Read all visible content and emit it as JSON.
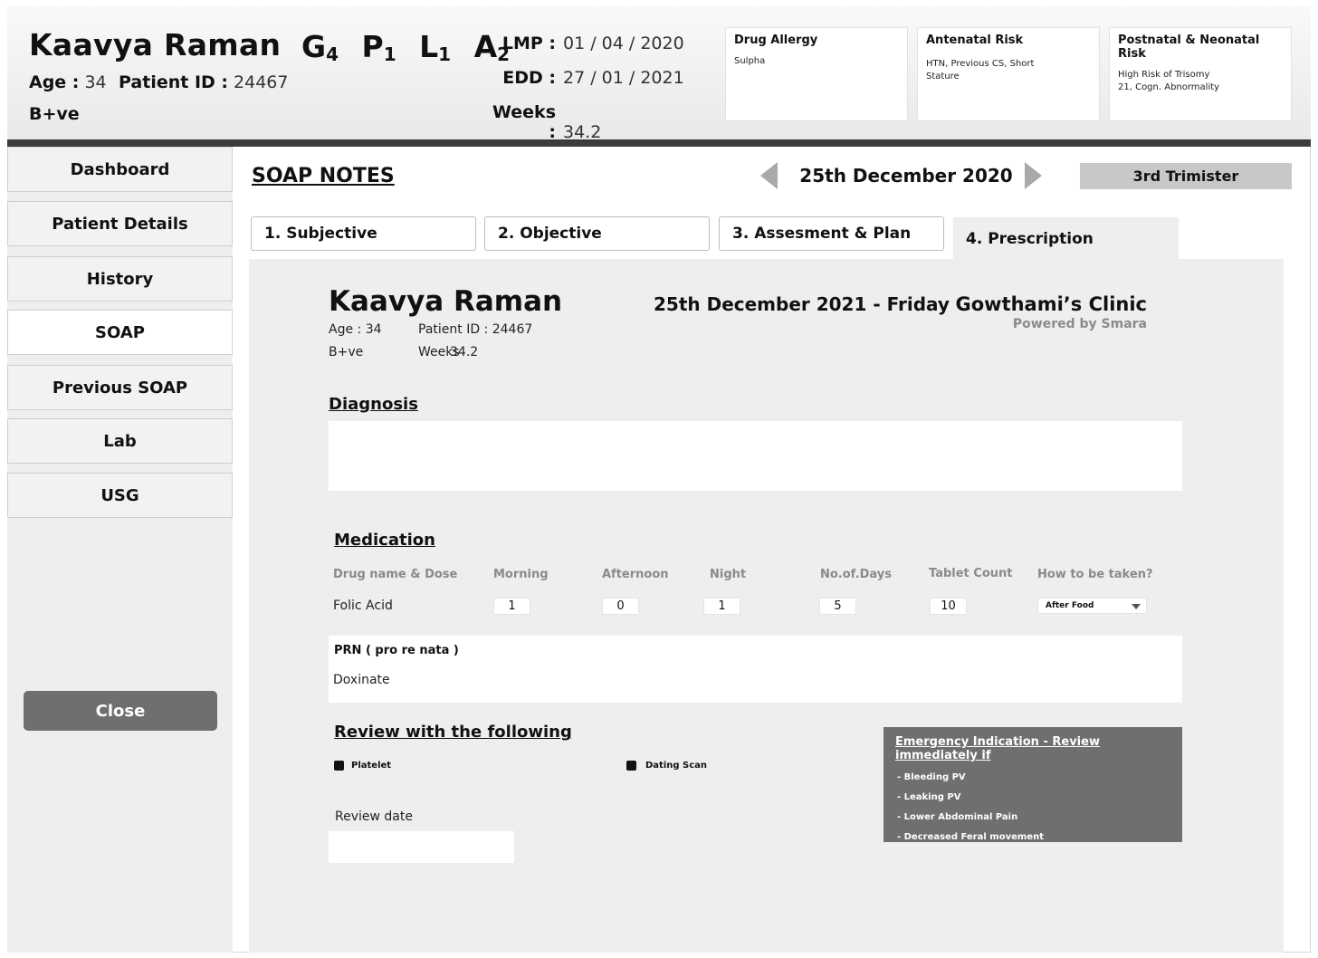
{
  "patient": {
    "name": "Kaavya Raman",
    "age_label": "Age :",
    "age": "34",
    "id_label": "Patient ID :",
    "id": "24467",
    "blood_group": "B+ve"
  },
  "obstetric": {
    "G": "G",
    "G_val": "4",
    "P": "P",
    "P_val": "1",
    "L": "L",
    "L_val": "1",
    "A": "A",
    "A_val": "2"
  },
  "dates": {
    "lmp_label": "LMP :",
    "lmp": "01 / 04 / 2020",
    "edd_label": "EDD :",
    "edd": "27 / 01 / 2021",
    "weeks_label": "Weeks :",
    "weeks": "34.2"
  },
  "risks": [
    {
      "title": "Drug Allergy",
      "detail": "Sulpha"
    },
    {
      "title": "Antenatal Risk",
      "detail": "HTN, Previous CS, Short Stature"
    },
    {
      "title": "Postnatal & Neonatal Risk",
      "detail": "High Risk of Trisomy 21, Cogn. Abnormality"
    }
  ],
  "sidebar": {
    "items": [
      {
        "label": "Dashboard"
      },
      {
        "label": "Patient Details"
      },
      {
        "label": "History"
      },
      {
        "label": "SOAP",
        "active": true
      },
      {
        "label": "Previous SOAP"
      },
      {
        "label": "Lab"
      },
      {
        "label": "USG"
      }
    ],
    "close_label": "Close"
  },
  "main": {
    "title": "SOAP NOTES",
    "current_date": "25th December 2020",
    "trimester": "3rd Trimister",
    "tabs": [
      {
        "label": "1. Subjective"
      },
      {
        "label": "2. Objective"
      },
      {
        "label": "3. Assesment & Plan"
      },
      {
        "label": "4. Prescription",
        "active": true
      }
    ]
  },
  "prescription": {
    "patient_name": "Kaavya Raman",
    "age_text": "Age : 34",
    "id_text": "Patient ID : 24467",
    "blood_group": "B+ve",
    "weeks_label": "Weeks",
    "weeks_value": "34.2",
    "date": "25th December 2021 - Friday",
    "clinic": "Gowthami’s Clinic",
    "powered_by": "Powered by Smara",
    "diagnosis_heading": "Diagnosis",
    "diagnosis": "",
    "medication_heading": "Medication",
    "columns": [
      "Drug name & Dose",
      "Morning",
      "Afternoon",
      "Night",
      "No.of.Days",
      "Tablet Count",
      "How to be taken?"
    ],
    "rows": [
      {
        "drug": "Folic Acid",
        "morning": "1",
        "afternoon": "0",
        "night": "1",
        "days": "5",
        "tablet_count": "10",
        "how": "After Food"
      }
    ],
    "prn_title": "PRN ( pro re nata )",
    "prn_value": "Doxinate",
    "review_heading": "Review with the following",
    "review_items": [
      "Platelet",
      "Dating Scan"
    ],
    "review_date_label": "Review date",
    "review_date": "",
    "emergency": {
      "title": "Emergency Indication - Review immediately if",
      "items": [
        "- Bleeding PV",
        "- Leaking PV",
        "- Lower Abdominal Pain",
        "- Decreased Feral movement"
      ]
    }
  },
  "colors": {
    "header_bar": "#3c3c3c",
    "panel": "#eeeeee",
    "close_button": "#6f6f6f",
    "emergency_box": "#6f6f6f",
    "trimester_badge": "#c8c8c8"
  }
}
